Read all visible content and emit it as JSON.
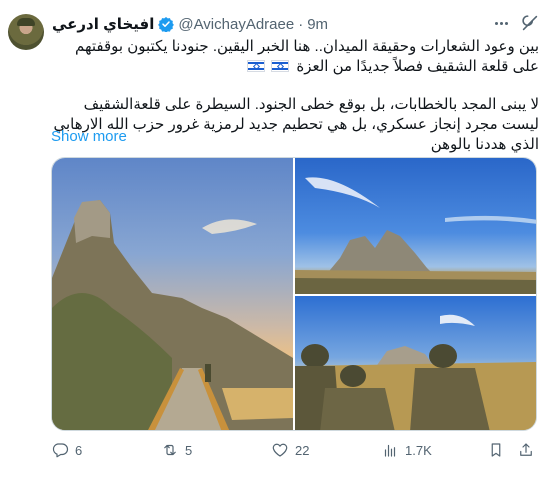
{
  "tweet": {
    "display_name": "افيخاي ادرعي",
    "handle": "@AvichayAdraee",
    "separator": "·",
    "time": "9m",
    "paragraph1": "بين وعود الشعارات وحقيقة الميدان.. هنا الخبر اليقين. جنودنا يكتبون بوقفتهم على قلعة الشقيف فصلاً جديدًا من العزة",
    "paragraph2": "لا يبنى المجد بالخطابات، بل بوقع خطى الجنود. السيطرة على قلعةالشقيف ليست مجرد إنجاز عسكري، بل هي تحطيم جديد لرمزية غرور حزب الله الارهابي الذي هددنا بالوهن",
    "show_more": "Show more",
    "flag_icon": "israel-flag-icon"
  },
  "actions": {
    "replies": "6",
    "reposts": "5",
    "likes": "22",
    "views": "1.7K"
  },
  "colors": {
    "link": "#1d9bf0",
    "muted": "#536471",
    "verified": "#1d9bf0",
    "text": "#0f1419"
  }
}
